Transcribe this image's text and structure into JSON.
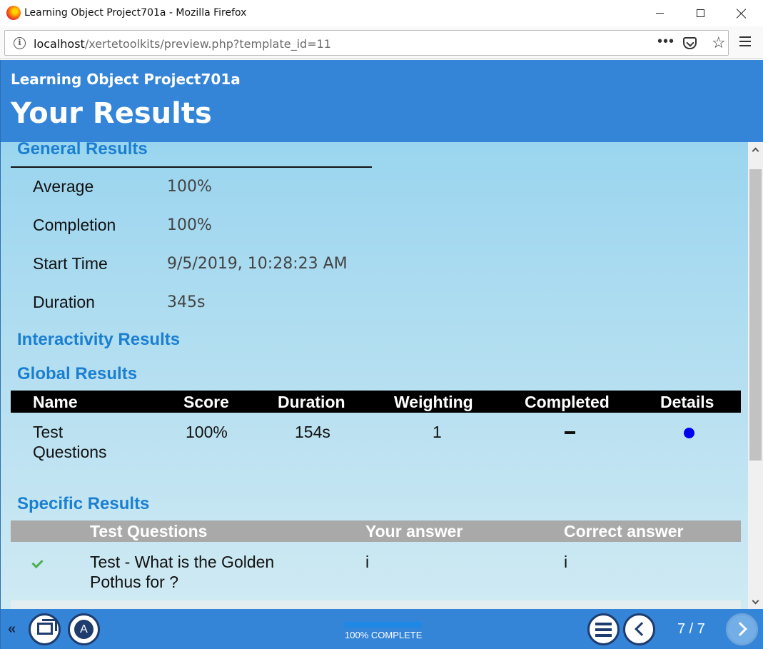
{
  "window": {
    "title": "Learning Object Project701a - Mozilla Firefox"
  },
  "browser": {
    "url_host": "localhost",
    "url_path": "/xertetoolkits/preview.php?template_id=11",
    "more_label": "•••",
    "star_glyph": "☆"
  },
  "header": {
    "project_title": "Learning Object Project701a",
    "page_title": "Your Results"
  },
  "general_results": {
    "heading": "General Results",
    "rows": [
      {
        "label": "Average",
        "value": "100%"
      },
      {
        "label": "Completion",
        "value": "100%"
      },
      {
        "label": "Start Time",
        "value": "9/5/2019, 10:28:23 AM"
      },
      {
        "label": "Duration",
        "value": "345s"
      }
    ]
  },
  "interactivity_results": {
    "heading": "Interactivity Results"
  },
  "global_results": {
    "heading": "Global Results",
    "columns": [
      "Name",
      "Score",
      "Duration",
      "Weighting",
      "Completed",
      "Details"
    ],
    "rows": [
      {
        "name_line1": "Test",
        "name_line2": "Questions",
        "score": "100%",
        "duration": "154s",
        "weighting": "1",
        "completed": "–"
      }
    ]
  },
  "specific_results": {
    "heading": "Specific Results",
    "columns": [
      "Test Questions",
      "Your answer",
      "Correct answer"
    ],
    "rows": [
      {
        "question_line1": "Test - What is the Golden",
        "question_line2": "Pothus for ?",
        "your_answer": "i",
        "correct_answer": "i",
        "status_icon": "check-icon"
      }
    ]
  },
  "footer": {
    "collapse_label": "«",
    "a_label": "A",
    "progress_percent": 100,
    "progress_text": "100% COMPLETE",
    "page_count": "7 / 7"
  },
  "colors": {
    "header_blue": "#3485d7",
    "heading_blue": "#1b7fd1",
    "check_green": "#4caf50",
    "details_dot": "#0000ee"
  }
}
